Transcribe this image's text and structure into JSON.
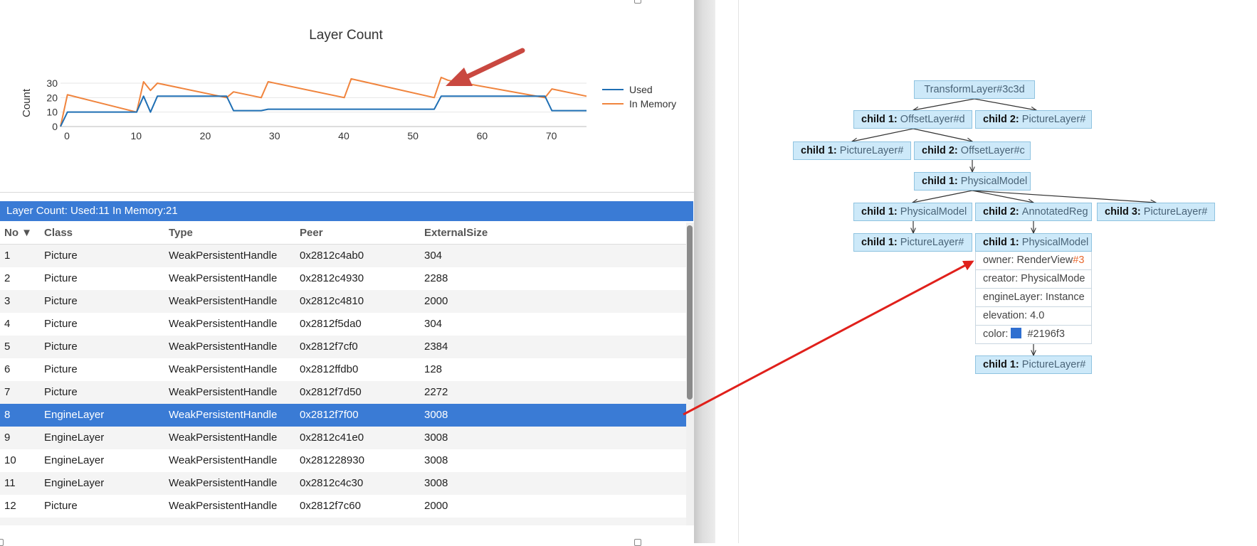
{
  "chart": {
    "chart_data": {
      "type": "line",
      "title": "Layer Count",
      "xlabel": "",
      "ylabel": "Count",
      "xlim": [
        0,
        76
      ],
      "ylim": [
        0,
        30
      ],
      "x_ticks": [
        0,
        10,
        20,
        30,
        40,
        50,
        60,
        70
      ],
      "y_ticks": [
        0,
        10,
        20,
        30
      ],
      "legend_position": "right",
      "grid": true,
      "series": [
        {
          "name": "Used",
          "color": "#1f6fb4",
          "x": [
            0,
            1,
            10,
            11,
            12,
            13,
            14,
            24,
            25,
            29,
            30,
            54,
            55,
            70,
            71,
            76
          ],
          "y": [
            0,
            10,
            10,
            10,
            21,
            10,
            21,
            21,
            11,
            11,
            12,
            12,
            21,
            21,
            11,
            11
          ]
        },
        {
          "name": "In Memory",
          "color": "#f0843d",
          "x": [
            0,
            1,
            11,
            12,
            13,
            14,
            24,
            25,
            29,
            30,
            41,
            42,
            54,
            55,
            56,
            70,
            71,
            76
          ],
          "y": [
            0,
            22,
            10,
            31,
            25,
            30,
            20,
            24,
            20,
            31,
            20,
            33,
            20,
            34,
            32,
            20,
            26,
            21
          ]
        }
      ]
    }
  },
  "table": {
    "title": "Layer Count: Used:11 In Memory:21",
    "headers": [
      "No ▼",
      "Class",
      "Type",
      "Peer",
      "ExternalSize"
    ],
    "selected_index": 7,
    "rows": [
      [
        "1",
        "Picture",
        "WeakPersistentHandle",
        "0x2812c4ab0",
        "304"
      ],
      [
        "2",
        "Picture",
        "WeakPersistentHandle",
        "0x2812c4930",
        "2288"
      ],
      [
        "3",
        "Picture",
        "WeakPersistentHandle",
        "0x2812c4810",
        "2000"
      ],
      [
        "4",
        "Picture",
        "WeakPersistentHandle",
        "0x2812f5da0",
        "304"
      ],
      [
        "5",
        "Picture",
        "WeakPersistentHandle",
        "0x2812f7cf0",
        "2384"
      ],
      [
        "6",
        "Picture",
        "WeakPersistentHandle",
        "0x2812ffdb0",
        "128"
      ],
      [
        "7",
        "Picture",
        "WeakPersistentHandle",
        "0x2812f7d50",
        "2272"
      ],
      [
        "8",
        "EngineLayer",
        "WeakPersistentHandle",
        "0x2812f7f00",
        "3008"
      ],
      [
        "9",
        "EngineLayer",
        "WeakPersistentHandle",
        "0x2812c41e0",
        "3008"
      ],
      [
        "10",
        "EngineLayer",
        "WeakPersistentHandle",
        "0x281228930",
        "3008"
      ],
      [
        "11",
        "EngineLayer",
        "WeakPersistentHandle",
        "0x2812c4c30",
        "3008"
      ],
      [
        "12",
        "Picture",
        "WeakPersistentHandle",
        "0x2812f7c60",
        "2000"
      ]
    ]
  },
  "tree": {
    "nodes": [
      {
        "id": "root",
        "label": "",
        "name": "TransformLayer#3c3d"
      },
      {
        "id": "n1",
        "label": "child 1: ",
        "name": "OffsetLayer#d"
      },
      {
        "id": "n2",
        "label": "child 2: ",
        "name": "PictureLayer#"
      },
      {
        "id": "n3",
        "label": "child 1: ",
        "name": "PictureLayer#"
      },
      {
        "id": "n4",
        "label": "child 2: ",
        "name": "OffsetLayer#c"
      },
      {
        "id": "n5",
        "label": "child 1: ",
        "name": "PhysicalModel"
      },
      {
        "id": "n6",
        "label": "child 1: ",
        "name": "PhysicalModel"
      },
      {
        "id": "n7",
        "label": "child 2: ",
        "name": "AnnotatedReg"
      },
      {
        "id": "n8",
        "label": "child 3: ",
        "name": "PictureLayer#"
      },
      {
        "id": "n9",
        "label": "child 1: ",
        "name": "PictureLayer#"
      },
      {
        "id": "n10",
        "label": "child 1: ",
        "name": "PhysicalModel"
      },
      {
        "id": "n11",
        "label": "child 1: ",
        "name": "PictureLayer#"
      }
    ],
    "properties": {
      "owner_label": "owner: RenderView",
      "owner_highlight": "#3",
      "creator": "creator: PhysicalMode",
      "engine_layer": "engineLayer: Instance",
      "elevation": "elevation: 4.0",
      "color_label": "color:",
      "color_value": "#2196f3",
      "color_hex": "#2f6fd0"
    }
  }
}
